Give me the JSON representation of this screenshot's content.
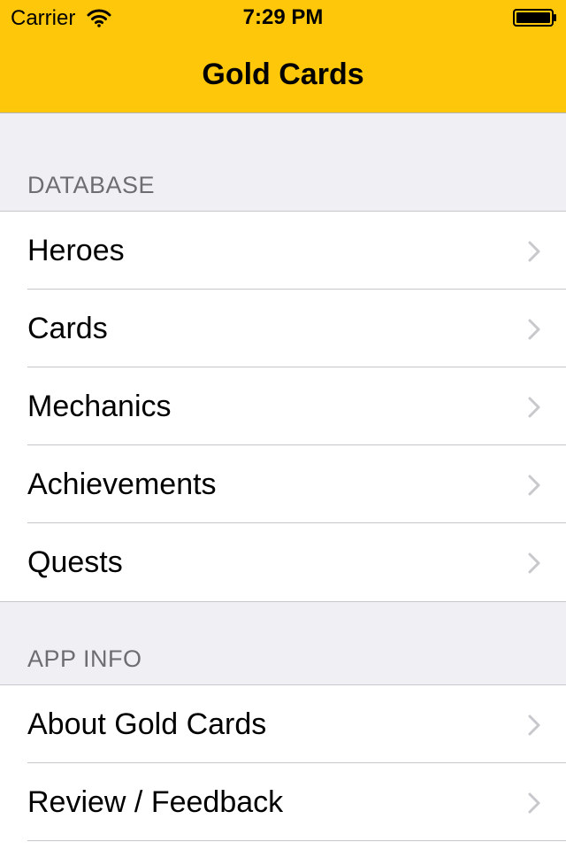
{
  "status_bar": {
    "carrier": "Carrier",
    "time": "7:29 PM",
    "wifi_icon": "wifi-icon",
    "battery_icon": "battery-icon"
  },
  "nav": {
    "title": "Gold Cards",
    "bar_color": "#ffc70a"
  },
  "sections": [
    {
      "header": "DATABASE",
      "items": [
        {
          "label": "Heroes",
          "icon": "chevron-right-icon"
        },
        {
          "label": "Cards",
          "icon": "chevron-right-icon"
        },
        {
          "label": "Mechanics",
          "icon": "chevron-right-icon"
        },
        {
          "label": "Achievements",
          "icon": "chevron-right-icon"
        },
        {
          "label": "Quests",
          "icon": "chevron-right-icon"
        }
      ]
    },
    {
      "header": "APP INFO",
      "items": [
        {
          "label": "About Gold Cards",
          "icon": "chevron-right-icon"
        },
        {
          "label": "Review / Feedback",
          "icon": "chevron-right-icon"
        }
      ]
    }
  ]
}
